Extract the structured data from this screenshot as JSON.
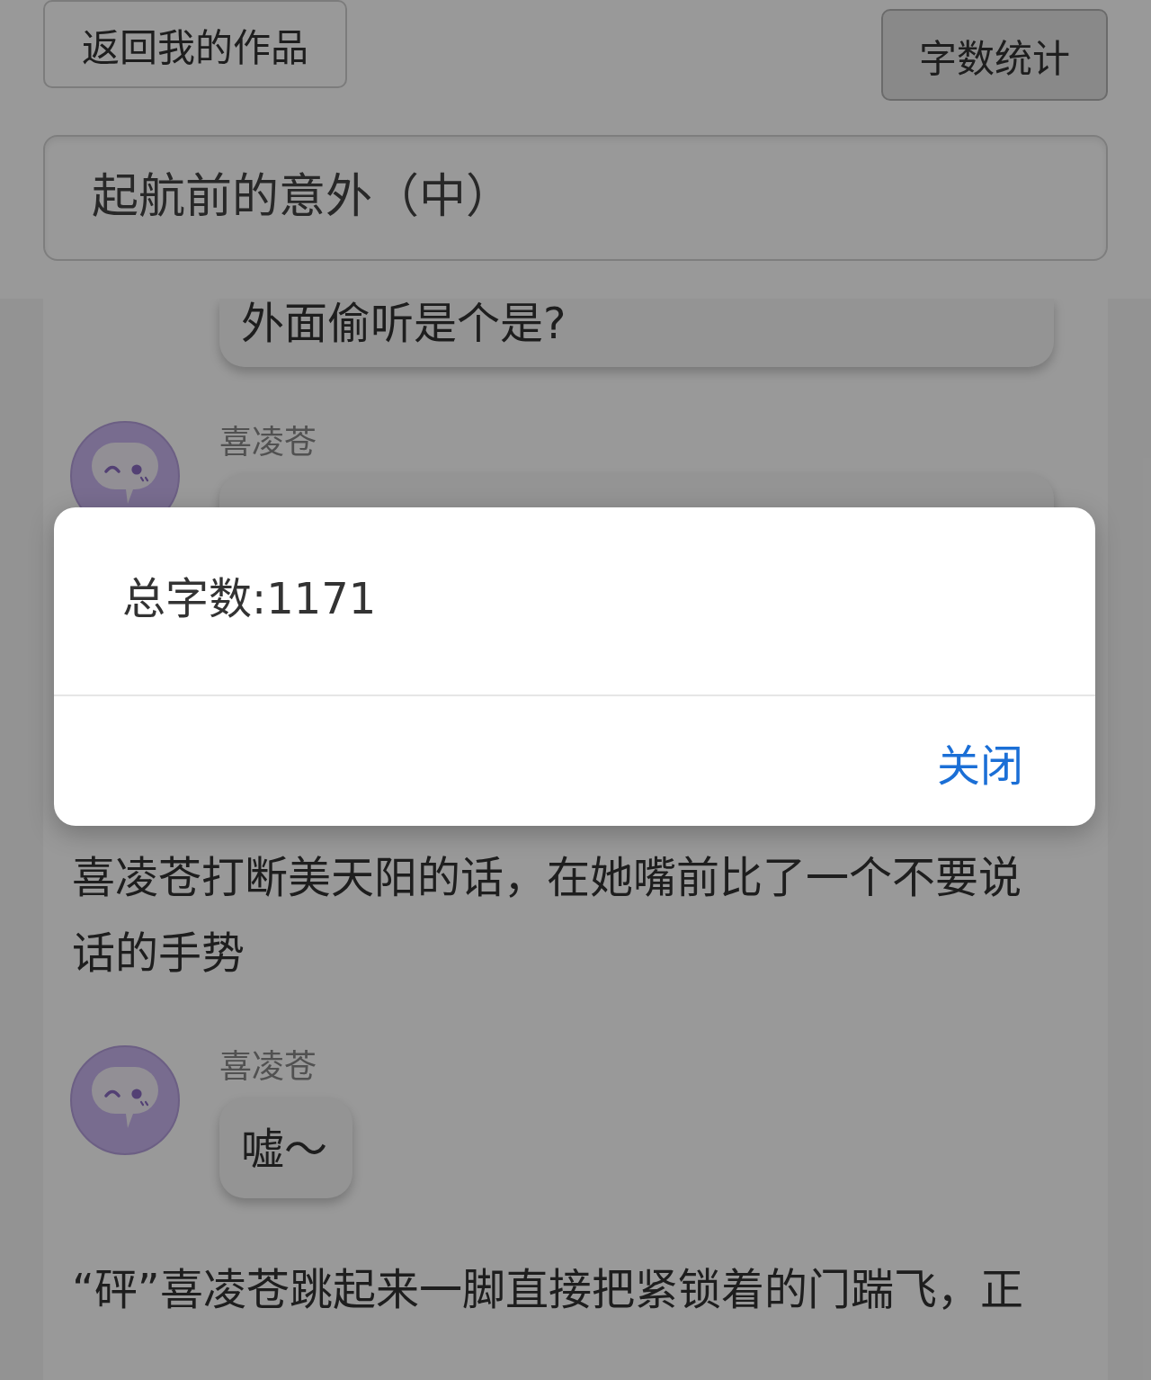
{
  "header": {
    "back_button": "返回我的作品",
    "word_count_button": "字数统计",
    "title_field": {
      "value": "起航前的意外（中）"
    }
  },
  "story": [
    {
      "kind": "message",
      "text": "外面偷听是个是?"
    },
    {
      "kind": "message",
      "name": "喜凌苍"
    },
    {
      "kind": "narration",
      "text": "喜凌苍打断美天阳的话，在她嘴前比了一个不要说话的手势"
    },
    {
      "kind": "message",
      "name": "喜凌苍",
      "text": "嘘～"
    },
    {
      "kind": "narration",
      "text": "“砰”喜凌苍跳起来一脚直接把紧锁着的门踹飞，正"
    }
  ],
  "dialog": {
    "message": "总字数:1171",
    "close_button": "关闭"
  }
}
